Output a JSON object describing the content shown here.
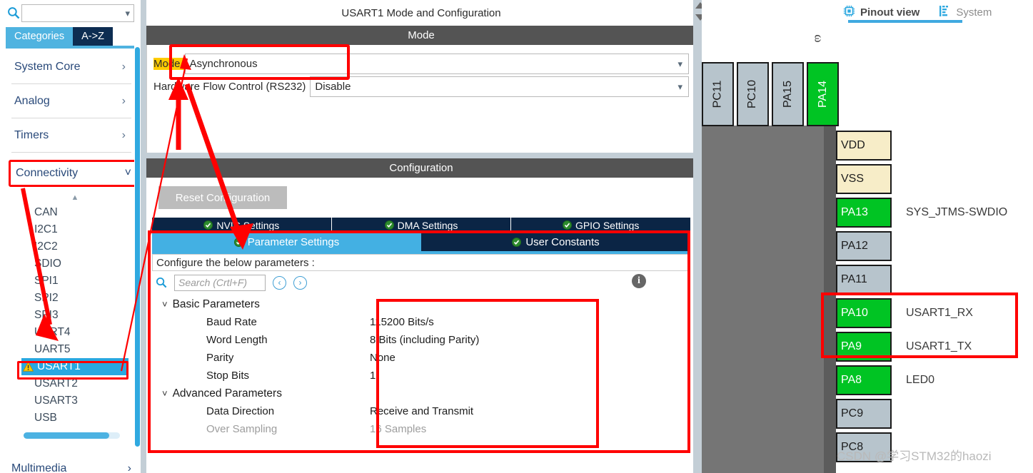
{
  "sidebar": {
    "search": {
      "value": "",
      "placeholder": "",
      "icon": "search-icon"
    },
    "tabs": [
      {
        "label": "Categories",
        "selected": true
      },
      {
        "label": "A->Z",
        "selected": false
      }
    ],
    "categories": [
      {
        "label": "System Core",
        "chevron": "›"
      },
      {
        "label": "Analog",
        "chevron": "›"
      },
      {
        "label": "Timers",
        "chevron": "›"
      }
    ],
    "connectivity": {
      "label": "Connectivity",
      "chevron": "⌄"
    },
    "peripherals": [
      {
        "label": "CAN",
        "active": false,
        "warning": false
      },
      {
        "label": "I2C1",
        "active": false,
        "warning": false
      },
      {
        "label": "I2C2",
        "active": false,
        "warning": false
      },
      {
        "label": "SDIO",
        "active": false,
        "warning": false
      },
      {
        "label": "SPI1",
        "active": false,
        "warning": false
      },
      {
        "label": "SPI2",
        "active": false,
        "warning": false
      },
      {
        "label": "SPI3",
        "active": false,
        "warning": false
      },
      {
        "label": "UART4",
        "active": false,
        "warning": false
      },
      {
        "label": "UART5",
        "active": false,
        "warning": false
      },
      {
        "label": "USART1",
        "active": true,
        "warning": true
      },
      {
        "label": "USART2",
        "active": false,
        "warning": false
      },
      {
        "label": "USART3",
        "active": false,
        "warning": false
      },
      {
        "label": "USB",
        "active": false,
        "warning": false
      }
    ],
    "multimedia": {
      "label": "Multimedia",
      "chevron": "›"
    }
  },
  "center": {
    "title": "USART1 Mode and Configuration",
    "mode_band": "Mode",
    "mode_row": {
      "label": "Mode",
      "value": "Asynchronous"
    },
    "flow_row": {
      "label": "Hardware Flow Control (RS232)",
      "value": "Disable"
    },
    "config_band": "Configuration",
    "reset_button": "Reset Configuration",
    "top_tabs": [
      {
        "label": "NVIC Settings",
        "icon": "check-circle-icon"
      },
      {
        "label": "DMA Settings",
        "icon": "check-circle-icon"
      },
      {
        "label": "GPIO Settings",
        "icon": "check-circle-icon"
      }
    ],
    "sub_tabs": [
      {
        "label": "Parameter Settings",
        "selected": true,
        "icon": "check-circle-icon"
      },
      {
        "label": "User Constants",
        "selected": false,
        "icon": "check-circle-icon"
      }
    ],
    "configure_hint": "Configure the below parameters :",
    "param_search": {
      "placeholder": "Search (Crtl+F)",
      "value": ""
    },
    "nav_prev": "‹",
    "nav_next": "›",
    "info_icon": "info-icon",
    "param_groups": [
      {
        "name": "Basic Parameters",
        "rows": [
          {
            "name": "Baud Rate",
            "value": "115200 Bits/s",
            "disabled": false
          },
          {
            "name": "Word Length",
            "value": "8 Bits (including Parity)",
            "disabled": false
          },
          {
            "name": "Parity",
            "value": "None",
            "disabled": false
          },
          {
            "name": "Stop Bits",
            "value": "1",
            "disabled": false
          }
        ]
      },
      {
        "name": "Advanced Parameters",
        "rows": [
          {
            "name": "Data Direction",
            "value": "Receive and Transmit",
            "disabled": false
          },
          {
            "name": "Over Sampling",
            "value": "16 Samples",
            "disabled": true
          }
        ]
      }
    ]
  },
  "right": {
    "view_tabs": [
      {
        "label": "Pinout view",
        "active": true,
        "icon": "chip-icon"
      },
      {
        "label": "System",
        "active": false,
        "icon": "list-icon"
      }
    ],
    "rotated_label": "ω",
    "top_pins": [
      {
        "label": "PC11",
        "state": "grey"
      },
      {
        "label": "PC10",
        "state": "grey"
      },
      {
        "label": "PA15",
        "state": "grey"
      },
      {
        "label": "PA14",
        "state": "green"
      }
    ],
    "right_pins": [
      {
        "label": "VDD",
        "state": "cream",
        "signal": ""
      },
      {
        "label": "VSS",
        "state": "cream",
        "signal": ""
      },
      {
        "label": "PA13",
        "state": "green",
        "signal": "SYS_JTMS-SWDIO"
      },
      {
        "label": "PA12",
        "state": "grey",
        "signal": ""
      },
      {
        "label": "PA11",
        "state": "grey",
        "signal": ""
      },
      {
        "label": "PA10",
        "state": "green",
        "signal": "USART1_RX"
      },
      {
        "label": "PA9",
        "state": "green",
        "signal": "USART1_TX"
      },
      {
        "label": "PA8",
        "state": "green",
        "signal": "LED0"
      },
      {
        "label": "PC9",
        "state": "grey",
        "signal": ""
      },
      {
        "label": "PC8",
        "state": "grey",
        "signal": ""
      }
    ],
    "watermark": "CSDN @学习STM32的haozi"
  },
  "colors": {
    "accent_blue": "#43b0e3",
    "dark_navy": "#0b2545",
    "green_pin": "#00c423",
    "highlight_yellow": "#ffcc00",
    "annotation_red": "#ff0000",
    "band_grey": "#545454"
  }
}
